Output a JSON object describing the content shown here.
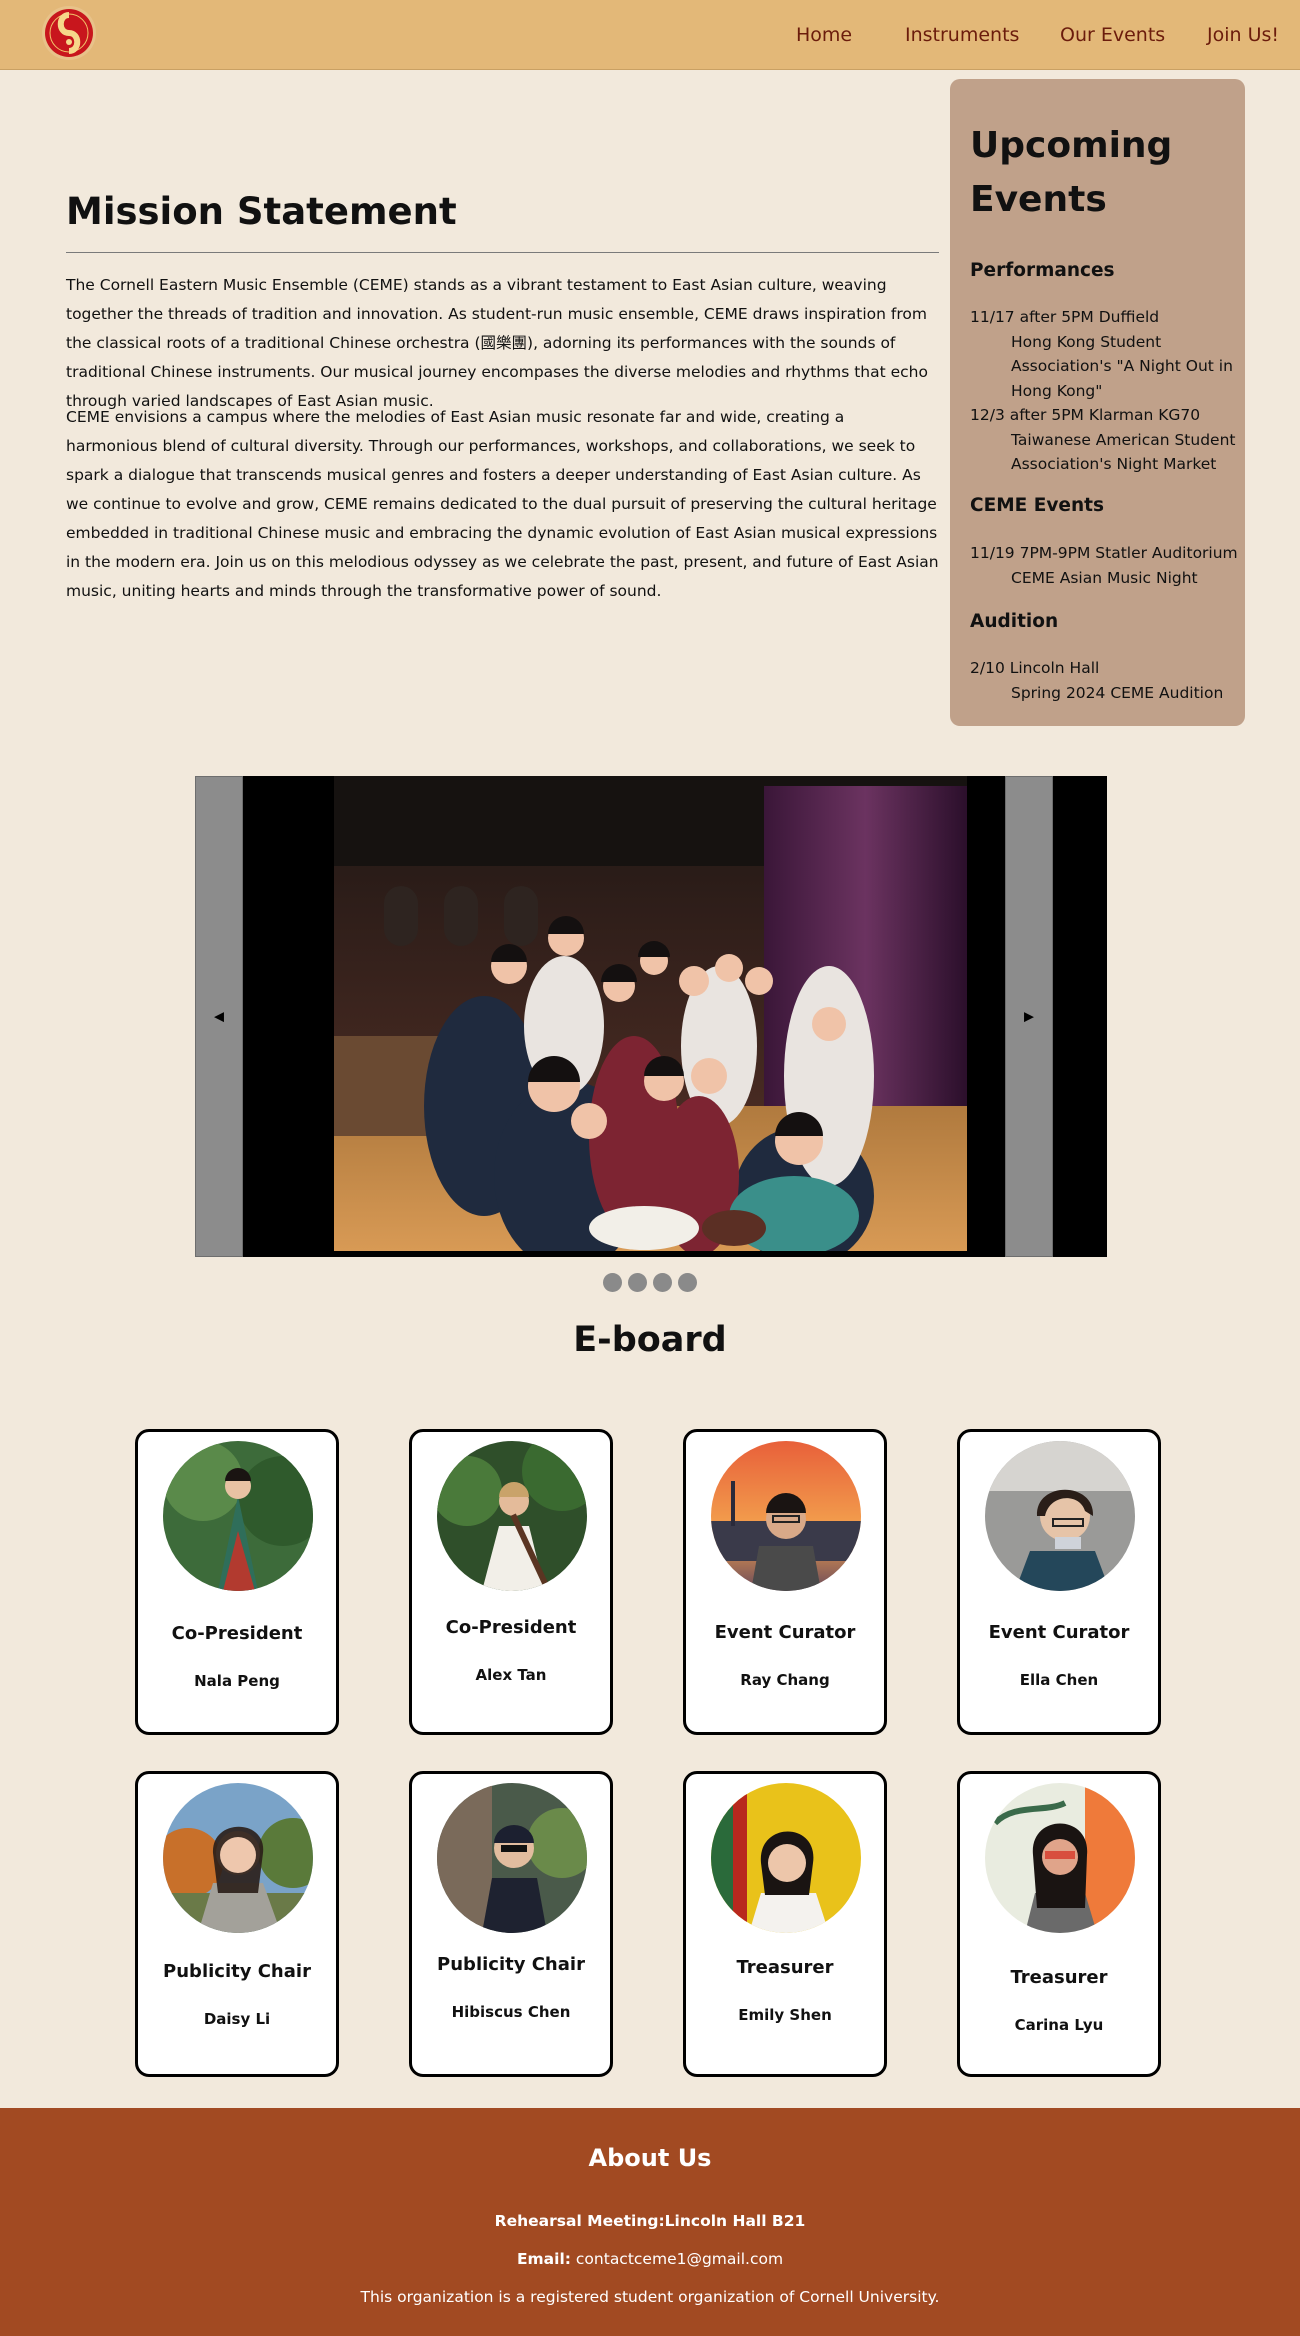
{
  "nav": {
    "logo_icon": "ceme-logo-icon",
    "links": [
      "Home",
      "Instruments",
      "Our Events",
      "Join Us!"
    ]
  },
  "mission": {
    "title": "Mission Statement",
    "paragraphs": [
      "The Cornell Eastern Music Ensemble (CEME) stands as a vibrant testament to East Asian culture, weaving together the threads of tradition and innovation. As student-run music ensemble, CEME draws inspiration from the classical roots of a traditional Chinese orchestra (國樂團), adorning its performances with the sounds of traditional Chinese instruments. Our musical journey encompases the diverse melodies and rhythms that echo through varied landscapes of East Asian music.",
      "CEME envisions a campus where the melodies of East Asian music resonate far and wide, creating a harmonious blend of cultural diversity. Through our performances, workshops, and collaborations, we seek to spark a dialogue that transcends musical genres and fosters a deeper understanding of East Asian culture. As we continue to evolve and grow, CEME remains dedicated to the dual pursuit of preserving the cultural heritage embedded in traditional Chinese music and embracing the dynamic evolution of East Asian musical expressions in the modern era. Join us on this melodious odyssey as we celebrate the past, present, and future of East Asian music, uniting hearts and minds through the transformative power of sound."
    ]
  },
  "events": {
    "title": "Upcoming Events",
    "sections": [
      {
        "heading": "Performances",
        "items": [
          {
            "date": "11/17 after 5PM Duffield",
            "desc": "Hong Kong Student Association's \"A Night Out in Hong Kong\""
          },
          {
            "date": "12/3 after 5PM Klarman KG70",
            "desc": "Taiwanese American Student Association's Night Market"
          }
        ]
      },
      {
        "heading": "CEME Events",
        "items": [
          {
            "date": "11/19 7PM-9PM Statler Auditorium",
            "desc": "CEME Asian Music Night"
          }
        ]
      },
      {
        "heading": "Audition",
        "items": [
          {
            "date": "2/10 Lincoln Hall",
            "desc": "Spring 2024 CEME Audition"
          }
        ]
      }
    ]
  },
  "slideshow": {
    "prev_label": "◀",
    "next_label": "▶",
    "slide_count": 4,
    "active_index": 0
  },
  "eboard": {
    "title": "E-board",
    "members": [
      {
        "role": "Co-President",
        "name": "Nala Peng"
      },
      {
        "role": "Co-President",
        "name": "Alex Tan"
      },
      {
        "role": "Event Curator",
        "name": "Ray Chang"
      },
      {
        "role": "Event Curator",
        "name": "Ella Chen"
      },
      {
        "role": "Publicity Chair",
        "name": "Daisy Li"
      },
      {
        "role": "Publicity Chair",
        "name": "Hibiscus Chen"
      },
      {
        "role": "Treasurer",
        "name": "Emily Shen"
      },
      {
        "role": "Treasurer",
        "name": "Carina Lyu"
      }
    ]
  },
  "footer": {
    "title": "About Us",
    "rehearsal": "Rehearsal Meeting:Lincoln Hall B21",
    "email_label": "Email:",
    "email": "contactceme1@gmail.com",
    "note": "This organization is a registered student organization of Cornell University."
  },
  "colors": {
    "nav_bg": "#e3b878",
    "page_bg": "#f2e9dc",
    "events_bg": "#c0a18a",
    "footer_bg": "#a24a22",
    "nav_link": "#6b1c0c",
    "logo_red": "#c8161d"
  }
}
